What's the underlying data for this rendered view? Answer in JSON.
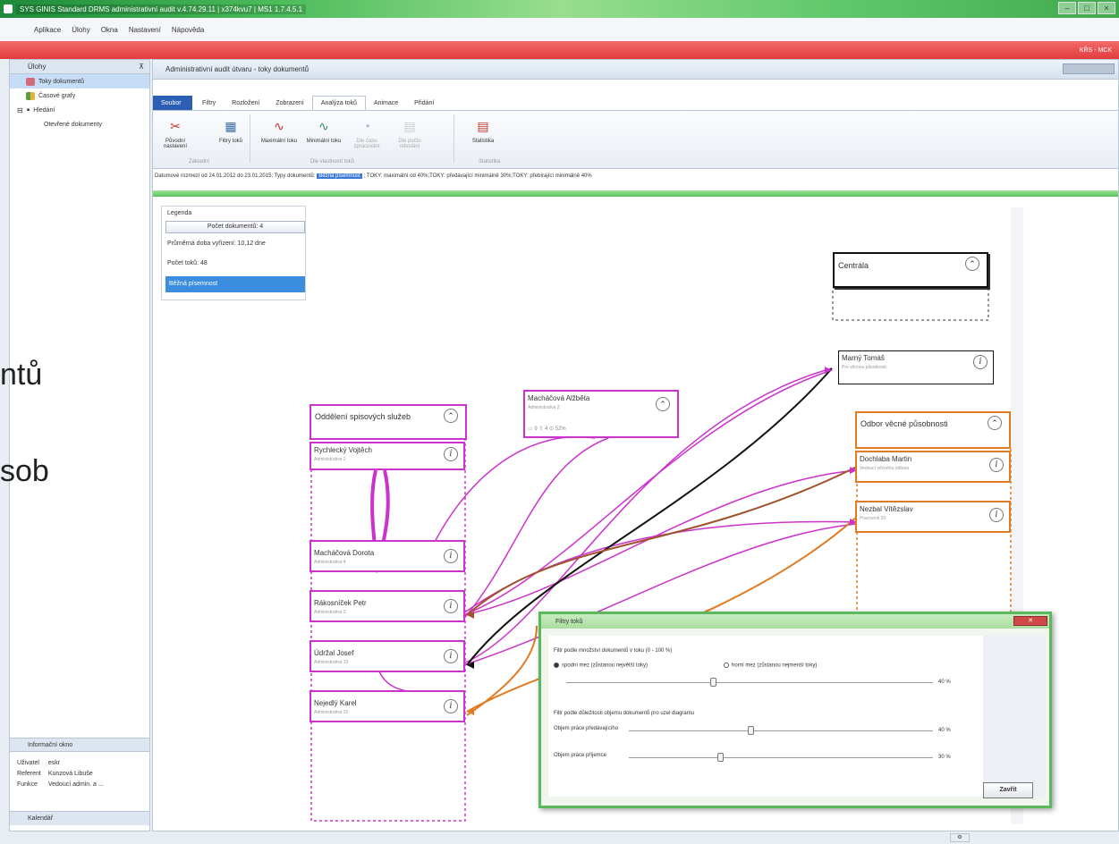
{
  "window": {
    "title": "SYS GINIS Standard DRMS administrativní audit v.4.74.29.11 | x374kvu7 | MS1 1.7.4.5.1"
  },
  "menu": [
    "Aplikace",
    "Úlohy",
    "Okna",
    "Nastavení",
    "Nápověda"
  ],
  "redbar_user": "KŘS - MCK",
  "left": {
    "header": "Úlohy",
    "tree": [
      {
        "label": "Toky dokumentů",
        "selected": true
      },
      {
        "label": "Časové grafy"
      },
      {
        "label": "Hledání"
      },
      {
        "label": "Otevřené dokumenty"
      }
    ],
    "info_header": "Informační okno",
    "info_rows": [
      {
        "k": "Uživatel",
        "v": "eskr"
      },
      {
        "k": "Referent",
        "v": "Kunzová Libuše"
      },
      {
        "k": "Funkce",
        "v": "Vedoucí admin. a ..."
      }
    ],
    "calendar": "Kalendář"
  },
  "doc": {
    "title": "Administrativní audit útvaru - toky dokumentů"
  },
  "tabs": [
    "Filtry",
    "Rozložení",
    "Zobrazení",
    "Analýza toků",
    "Animace",
    "Přidání"
  ],
  "file_tab": "Soubor",
  "active_tab": "Analýza toků",
  "ribbon": {
    "b1": "Původní nastavení",
    "b2": "Filtry toků",
    "b3": "Maximální toku",
    "b4": "Minimální toku",
    "b5": "Dle času zpracování",
    "b6": "Dle počtu odeslání",
    "b7": "Statistika",
    "g1": "Základní",
    "g2": "Dle vlastností toků",
    "g3": "Statistika"
  },
  "filterline": {
    "pre": "Datumové rozmezí od 24.01.2012 do 23.01.2015; Typy dokumentů:",
    "highlight": "Běžná písemnost",
    "post": "; TOKY: maximální od 40%;TOKY: předávající minimálně 30%;TOKY: přebírající minimálně 40%"
  },
  "legend": {
    "title": "Legenda",
    "count": "Počet dokumentů: 4",
    "avg": "Průměrná doba vyřízení: 10,12 dne",
    "flows": "Počet toků: 48",
    "selected": "Běžná písemnost"
  },
  "groups": {
    "centrala": "Centrála",
    "spis": "Oddělení spisových služeb",
    "odbor": "Odbor věcné působnosti"
  },
  "nodes": {
    "marny": {
      "name": "Marný Tomáš",
      "sub": "Pro věcnou působnost"
    },
    "machalova_a": {
      "name": "Macháčová Alžběta",
      "sub": "Administrativa 2",
      "metrics": "▭ 9   ⇧ 4   ⊙ 52%"
    },
    "rychlecky": {
      "name": "Rychlecký Vojtěch",
      "sub": "Administrativa 2"
    },
    "machalova_d": {
      "name": "Macháčová Dorota",
      "sub": "Administrativa 4"
    },
    "rakosnicek": {
      "name": "Rákosníček Petr",
      "sub": "Administrativa 3"
    },
    "udrzal": {
      "name": "Údržal Josef",
      "sub": "Administrativa 10"
    },
    "nejedly": {
      "name": "Nejedlý Karel",
      "sub": "Administrativa 20"
    },
    "dochlaba": {
      "name": "Dochlaba Martin",
      "sub": "Vedoucí věcného odboru"
    },
    "nezbal": {
      "name": "Nezbal Vítězslav",
      "sub": "Pracovník 20"
    }
  },
  "dialog": {
    "title": "Filtry toků",
    "sec1": "Filtr podle množství dokumentů v toku (0 - 100 %)",
    "radio1": "spodní mez (zůstanou největší toky)",
    "radio2": "horní mez (zůstanou nejmenší toky)",
    "pct1": "40 %",
    "sec2": "Filtr podle důležitosti objemu dokumentů pro uzel diagramu",
    "lab1": "Objem práce předávajícího",
    "pct2": "40 %",
    "lab2": "Objem práce příjemce",
    "pct3": "30 %",
    "slider1": 0.4,
    "slider2": 0.4,
    "slider3": 0.3,
    "close": "Zavřít"
  },
  "overlay": {
    "line1": "ntů",
    "line2": "sob"
  },
  "colors": {
    "magenta": "#cc33cc",
    "orange": "#e07b22",
    "black": "#111111",
    "brown": "#a0522d"
  }
}
